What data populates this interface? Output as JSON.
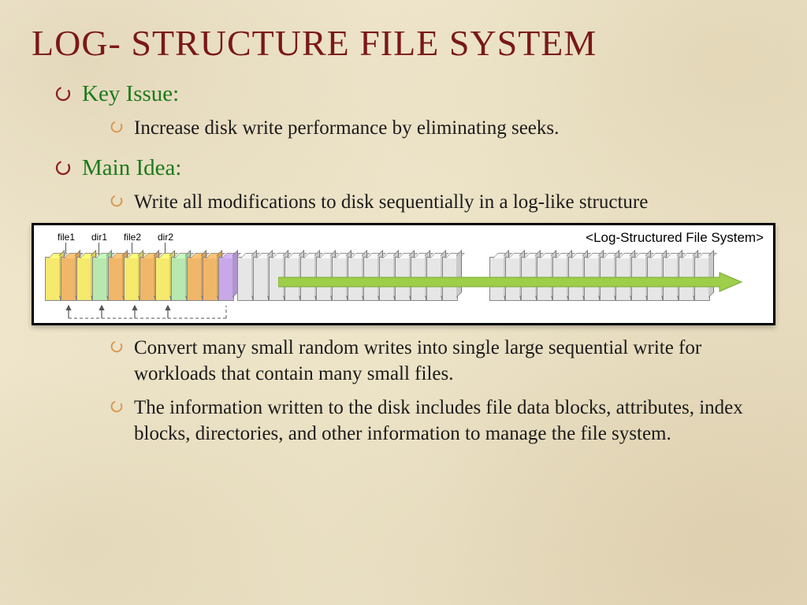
{
  "title": "LOG- STRUCTURE FILE SYSTEM",
  "sections": {
    "key_issue": {
      "heading": "Key Issue:",
      "items": [
        " Increase disk write performance by eliminating seeks."
      ]
    },
    "main_idea": {
      "heading": "Main Idea:",
      "items_before": [
        "Write all modifications to disk sequentially in a log-like structure"
      ],
      "items_after": [
        "Convert many small random writes into single large sequential write for workloads that contain many small files.",
        "The information written to the disk includes file data blocks, attributes, index blocks, directories, and other information to manage the file system."
      ]
    }
  },
  "diagram": {
    "title": "<Log-Structured File System>",
    "labels": [
      "file1",
      "dir1",
      "file2",
      "dir2"
    ]
  }
}
